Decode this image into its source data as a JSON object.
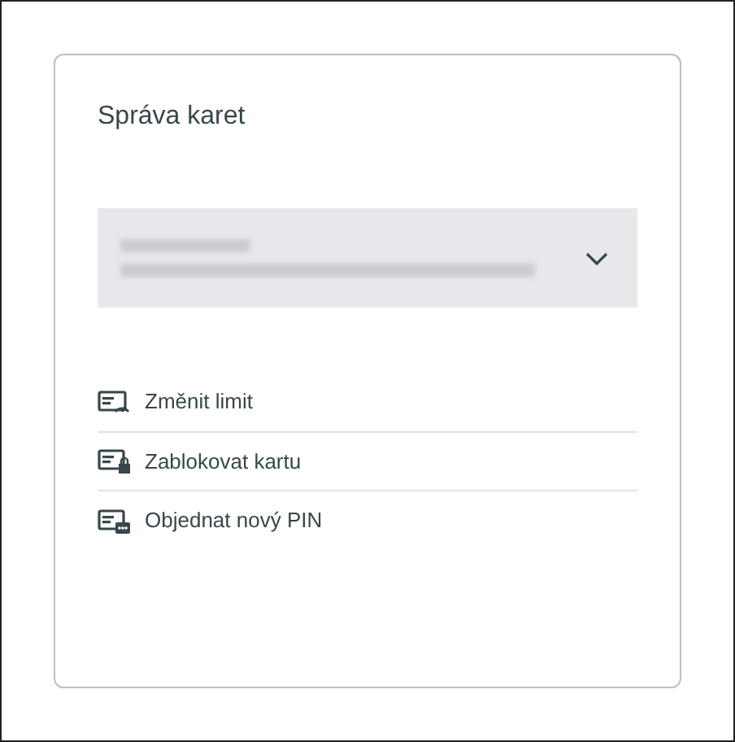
{
  "card": {
    "title": "Správa karet"
  },
  "card_select": {
    "expanded": false
  },
  "actions": [
    {
      "kind": "limit",
      "label": "Změnit limit"
    },
    {
      "kind": "block",
      "label": "Zablokovat kartu"
    },
    {
      "kind": "pin",
      "label": "Objednat nový PIN"
    }
  ]
}
